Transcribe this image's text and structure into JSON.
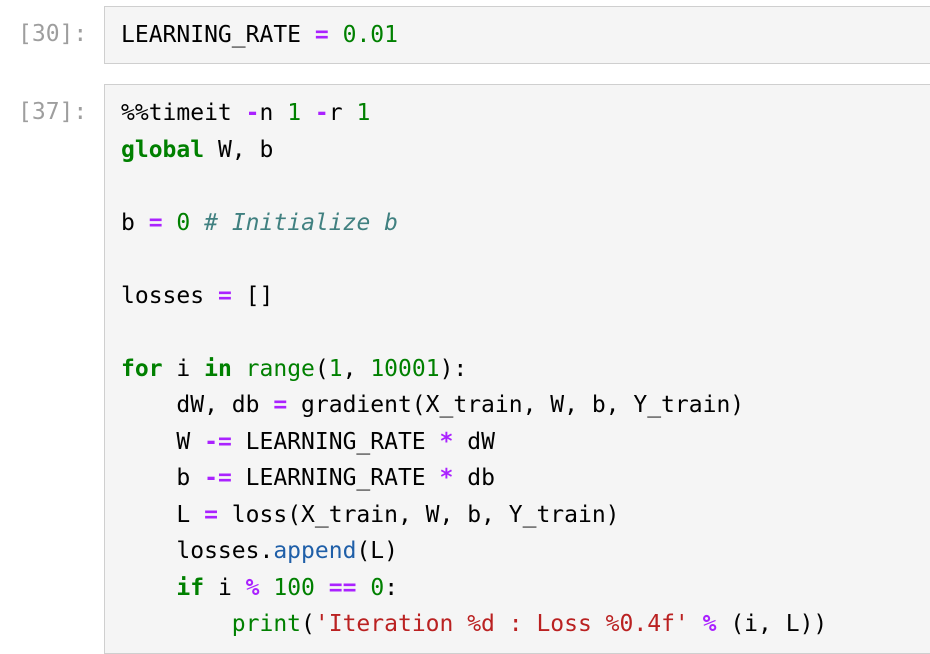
{
  "cells": [
    {
      "prompt": "[30]:",
      "lines": [
        [
          [
            "plain",
            "LEARNING_RATE "
          ],
          [
            "op",
            "="
          ],
          [
            "plain",
            " "
          ],
          [
            "num",
            "0.01"
          ]
        ]
      ]
    },
    {
      "prompt": "[37]:",
      "lines": [
        [
          [
            "plain",
            "%%timeit "
          ],
          [
            "op",
            "-"
          ],
          [
            "plain",
            "n "
          ],
          [
            "num",
            "1"
          ],
          [
            "plain",
            " "
          ],
          [
            "op",
            "-"
          ],
          [
            "plain",
            "r "
          ],
          [
            "num",
            "1"
          ]
        ],
        [
          [
            "kw",
            "global"
          ],
          [
            "plain",
            " W, b"
          ]
        ],
        [],
        [
          [
            "plain",
            "b "
          ],
          [
            "op",
            "="
          ],
          [
            "plain",
            " "
          ],
          [
            "num",
            "0"
          ],
          [
            "plain",
            " "
          ],
          [
            "cm",
            "# Initialize b"
          ]
        ],
        [],
        [
          [
            "plain",
            "losses "
          ],
          [
            "op",
            "="
          ],
          [
            "plain",
            " []"
          ]
        ],
        [],
        [
          [
            "kw",
            "for"
          ],
          [
            "plain",
            " i "
          ],
          [
            "kw",
            "in"
          ],
          [
            "plain",
            " "
          ],
          [
            "bi",
            "range"
          ],
          [
            "plain",
            "("
          ],
          [
            "num",
            "1"
          ],
          [
            "plain",
            ", "
          ],
          [
            "num",
            "10001"
          ],
          [
            "plain",
            "):"
          ]
        ],
        [
          [
            "plain",
            "    dW, db "
          ],
          [
            "op",
            "="
          ],
          [
            "plain",
            " gradient(X_train, W, b, Y_train)"
          ]
        ],
        [
          [
            "plain",
            "    W "
          ],
          [
            "op",
            "-="
          ],
          [
            "plain",
            " LEARNING_RATE "
          ],
          [
            "op",
            "*"
          ],
          [
            "plain",
            " dW"
          ]
        ],
        [
          [
            "plain",
            "    b "
          ],
          [
            "op",
            "-="
          ],
          [
            "plain",
            " LEARNING_RATE "
          ],
          [
            "op",
            "*"
          ],
          [
            "plain",
            " db"
          ]
        ],
        [
          [
            "plain",
            "    L "
          ],
          [
            "op",
            "="
          ],
          [
            "plain",
            " loss(X_train, W, b, Y_train)"
          ]
        ],
        [
          [
            "plain",
            "    losses."
          ],
          [
            "attr",
            "append"
          ],
          [
            "plain",
            "(L)"
          ]
        ],
        [
          [
            "plain",
            "    "
          ],
          [
            "kw",
            "if"
          ],
          [
            "plain",
            " i "
          ],
          [
            "op",
            "%"
          ],
          [
            "plain",
            " "
          ],
          [
            "num",
            "100"
          ],
          [
            "plain",
            " "
          ],
          [
            "op",
            "=="
          ],
          [
            "plain",
            " "
          ],
          [
            "num",
            "0"
          ],
          [
            "plain",
            ":"
          ]
        ],
        [
          [
            "plain",
            "        "
          ],
          [
            "bi",
            "print"
          ],
          [
            "plain",
            "("
          ],
          [
            "str",
            "'Iteration %d : Loss %0.4f'"
          ],
          [
            "plain",
            " "
          ],
          [
            "op",
            "%"
          ],
          [
            "plain",
            " (i, L))"
          ]
        ]
      ]
    }
  ],
  "colors": {
    "keyword": "#008000",
    "operator": "#aa22ff",
    "string": "#ba2121",
    "comment": "#408080",
    "attribute": "#1f5fa8",
    "prompt": "#9e9e9e",
    "editor_background": "#f5f5f5"
  }
}
